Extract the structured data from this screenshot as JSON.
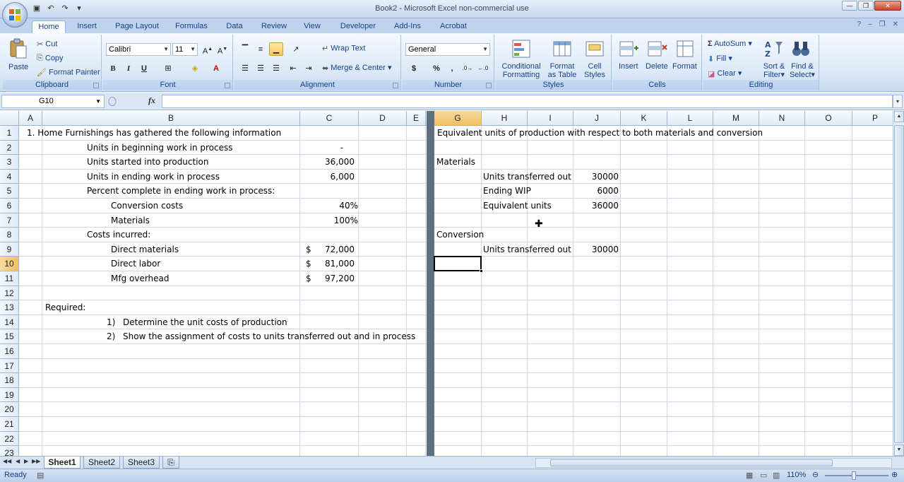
{
  "window": {
    "title": "Book2 - Microsoft Excel non-commercial use"
  },
  "ribbon_tabs": [
    "Home",
    "Insert",
    "Page Layout",
    "Formulas",
    "Data",
    "Review",
    "View",
    "Developer",
    "Add-Ins",
    "Acrobat"
  ],
  "active_tab": "Home",
  "clipboard": {
    "paste": "Paste",
    "cut": "Cut",
    "copy": "Copy",
    "format_painter": "Format Painter",
    "label": "Clipboard"
  },
  "font": {
    "name": "Calibri",
    "size": "11",
    "bold": "B",
    "italic": "I",
    "underline": "U",
    "label": "Font"
  },
  "alignment": {
    "wrap_text": "Wrap Text",
    "merge_center": "Merge & Center",
    "label": "Alignment"
  },
  "number": {
    "format": "General",
    "currency": "$",
    "percent": "%",
    "comma": ",",
    "label": "Number"
  },
  "styles": {
    "conditional_formatting": [
      "Conditional",
      "Formatting"
    ],
    "format_as_table": [
      "Format",
      "as Table"
    ],
    "cell_styles": [
      "Cell",
      "Styles"
    ],
    "label": "Styles"
  },
  "cells_group": {
    "insert": "Insert",
    "delete": "Delete",
    "format": "Format",
    "label": "Cells"
  },
  "editing": {
    "autosum": "AutoSum",
    "fill": "Fill",
    "clear": "Clear",
    "sort_filter": [
      "Sort &",
      "Filter"
    ],
    "find_select": [
      "Find &",
      "Select"
    ],
    "label": "Editing"
  },
  "formula_bar": {
    "name_box": "G10",
    "fx": "fx",
    "formula": ""
  },
  "columns_left": [
    "A",
    "B",
    "C",
    "D",
    "E",
    "F"
  ],
  "columns_right": [
    "G",
    "H",
    "I",
    "J",
    "K",
    "L",
    "M",
    "N",
    "O",
    "P"
  ],
  "rows": [
    "1",
    "2",
    "3",
    "4",
    "5",
    "6",
    "7",
    "8",
    "9",
    "10",
    "11",
    "12",
    "13",
    "14",
    "15",
    "16",
    "17",
    "18",
    "19",
    "20",
    "21",
    "22",
    "23"
  ],
  "cells": {
    "A1": "1. Home Furnishings has gathered the following information",
    "B2": "Units in beginning work in process",
    "C2": "-",
    "B3": "Units started into production",
    "C3": "36,000",
    "B4": "Units in ending work in process",
    "C4": "6,000",
    "B5": "Percent complete in ending work in process:",
    "B6": "Conversion costs",
    "C6": "40%",
    "B7": "Materials",
    "C7": "100%",
    "B8": "Costs incurred:",
    "B9": "Direct materials",
    "C9_sym": "$",
    "C9": "72,000",
    "B10": "Direct labor",
    "C10_sym": "$",
    "C10": "81,000",
    "B11": "Mfg overhead",
    "C11_sym": "$",
    "C11": "97,200",
    "A13": "Required:",
    "B14_num": "1)",
    "B14": "Determine the unit costs of production",
    "B15_num": "2)",
    "B15": "Show the assignment of costs to units transferred out and in process",
    "G1": "Equivalent units of production with respect to both materials and conversion",
    "G3": "Materials",
    "H4": "Units transferred out",
    "J4": "30000",
    "H5": "Ending WIP",
    "J5": "6000",
    "H6": "Equivalent units",
    "J6": "36000",
    "G8": "Conversion",
    "H9": "Units transferred out",
    "J9": "30000"
  },
  "sheet_tabs": [
    "Sheet1",
    "Sheet2",
    "Sheet3"
  ],
  "active_sheet": "Sheet1",
  "status": {
    "mode": "Ready",
    "zoom": "110%"
  },
  "colors": {
    "ribbon_text": "#15428b",
    "selection_header": "#f1c15f",
    "grid": "#d0d7e5"
  }
}
